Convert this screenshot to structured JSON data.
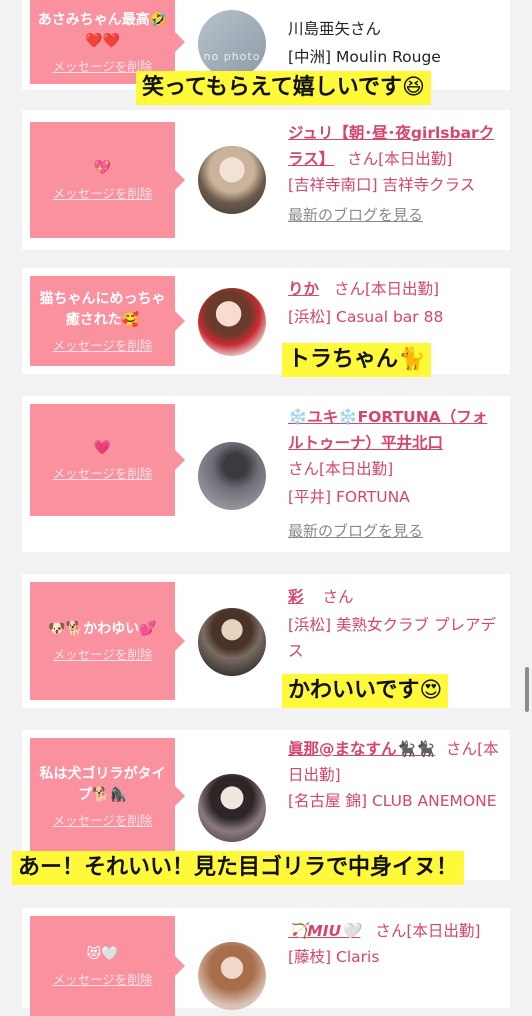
{
  "cards": [
    {
      "message": "あさみちゃん最高🤣❤️❤️",
      "delete_label": "メッセージを削除",
      "avatar_placeholder": "no photo",
      "name": "川島亜矢さん",
      "area": "[中洲] Moulin Rouge"
    },
    {
      "message": "💖",
      "delete_label": "メッセージを削除",
      "name": "ジュリ【朝･昼･夜girlsbarクラス】",
      "san": "さん",
      "status": "[本日出勤]",
      "area": "[吉祥寺南口] 吉祥寺クラス",
      "blog_link": "最新のブログを見る"
    },
    {
      "message": "猫ちゃんにめっちゃ癒された🥰",
      "delete_label": "メッセージを削除",
      "name": "りか",
      "san": "さん",
      "status": "[本日出勤]",
      "area": "[浜松] Casual bar 88"
    },
    {
      "message": "💗",
      "delete_label": "メッセージを削除",
      "name": "❄️ユキ❄️FORTUNA（フォルトゥーナ）平井北口",
      "san": "さん",
      "status": "[本日出勤]",
      "area": "[平井] FORTUNA",
      "blog_link": "最新のブログを見る"
    },
    {
      "message": "🐶🐕かわゆい💕",
      "delete_label": "メッセージを削除",
      "name": "彩",
      "san": "さん",
      "area": "[浜松] 美熟女クラブ プレアデス"
    },
    {
      "message": "私は犬ゴリラがタイプ🐕🦍",
      "delete_label": "メッセージを削除",
      "name": "眞那@まなすん🐈‍⬛🐈‍⬛",
      "san": "さん",
      "status": "[本日出勤]",
      "area": "[名古屋 錦] CLUB ANEMONE"
    },
    {
      "message": "😻🤍",
      "delete_label": "メッセージを削除",
      "name": "🏹MIU🤍",
      "san": "さん",
      "status": "[本日出勤]",
      "area": "[藤枝] Claris"
    }
  ],
  "captions": {
    "c1": "笑ってもらえて嬉しいです😆",
    "c2": "トラちゃん🐈",
    "c3": "かわいいです😍",
    "c4": "あー！それいい！見た目ゴリラで中身イヌ！"
  },
  "colors": {
    "bubble": "#f9919f",
    "name_pink": "#d6456b",
    "caption_bg": "#fff93a",
    "background": "#f2f2f2"
  }
}
